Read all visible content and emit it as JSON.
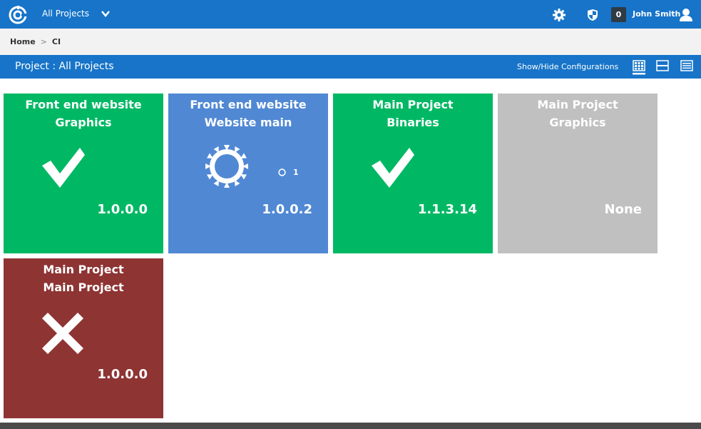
{
  "topbar": {
    "projects_label": "All Projects",
    "notification_count": "0",
    "username": "John Smith",
    "icons": [
      "logo-icon",
      "chevron-down-icon",
      "gear-icon",
      "shield-icon",
      "user-icon"
    ]
  },
  "breadcrumb": {
    "home": "Home",
    "separator": ">",
    "current": "CI"
  },
  "section": {
    "title": "Project : All Projects",
    "show_hide_label": "Show/Hide Configurations",
    "view_icons": [
      "grid-view-icon",
      "row-view-icon",
      "list-view-icon"
    ]
  },
  "tiles": [
    {
      "line1": "Front end website",
      "line2": "Graphics",
      "version": "1.0.0.0",
      "status": "success",
      "color": "#00b864"
    },
    {
      "line1": "Front end website",
      "line2": "Website main",
      "version": "1.0.0.2",
      "status": "building",
      "running_count": "1",
      "color": "#5088d4"
    },
    {
      "line1": "Main Project",
      "line2": "Binaries",
      "version": "1.1.3.14",
      "status": "success",
      "color": "#00b864"
    },
    {
      "line1": "Main Project",
      "line2": "Graphics",
      "version": "None",
      "status": "none",
      "color": "#c0c0c0"
    },
    {
      "line1": "Main Project",
      "line2": "Main Project",
      "version": "1.0.0.0",
      "status": "failed",
      "color": "#8e3433"
    }
  ],
  "colors": {
    "header_blue": "#1774c8",
    "success_green": "#00b864",
    "building_blue": "#5088d4",
    "none_gray": "#c0c0c0",
    "failed_red": "#8e3433"
  }
}
